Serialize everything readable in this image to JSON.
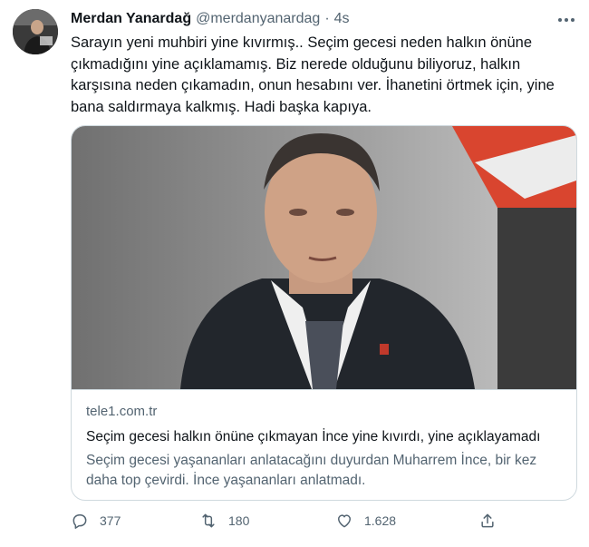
{
  "tweet": {
    "author_name": "Merdan Yanardağ",
    "author_handle": "@merdanyanardag",
    "separator": "·",
    "timestamp": "4s",
    "text": "Sarayın yeni muhbiri yine kıvırmış.. Seçim gecesi neden halkın önüne çıkmadığını yine açıklamamış. Biz nerede olduğunu biliyoruz, halkın karşısına neden çıkamadın, onun hesabını ver. İhanetini örtmek için, yine bana saldırmaya kalkmış. Hadi başka kapıya."
  },
  "card": {
    "domain": "tele1.com.tr",
    "title": "Seçim gecesi halkın önüne çıkmayan İnce yine kıvırdı, yine açıklayamadı",
    "description": "Seçim gecesi yaşananları anlatacağını duyurdan Muharrem İnce, bir kez daha top çevirdi. İnce yaşananları anlatmadı."
  },
  "actions": {
    "reply_count": "377",
    "retweet_count": "180",
    "like_count": "1.628"
  },
  "icons": {
    "more": "more-icon",
    "reply": "reply-icon",
    "retweet": "retweet-icon",
    "like": "like-icon",
    "share": "share-icon"
  },
  "colors": {
    "text_primary": "#0f1419",
    "text_secondary": "#536471",
    "border": "#cfd9de"
  }
}
